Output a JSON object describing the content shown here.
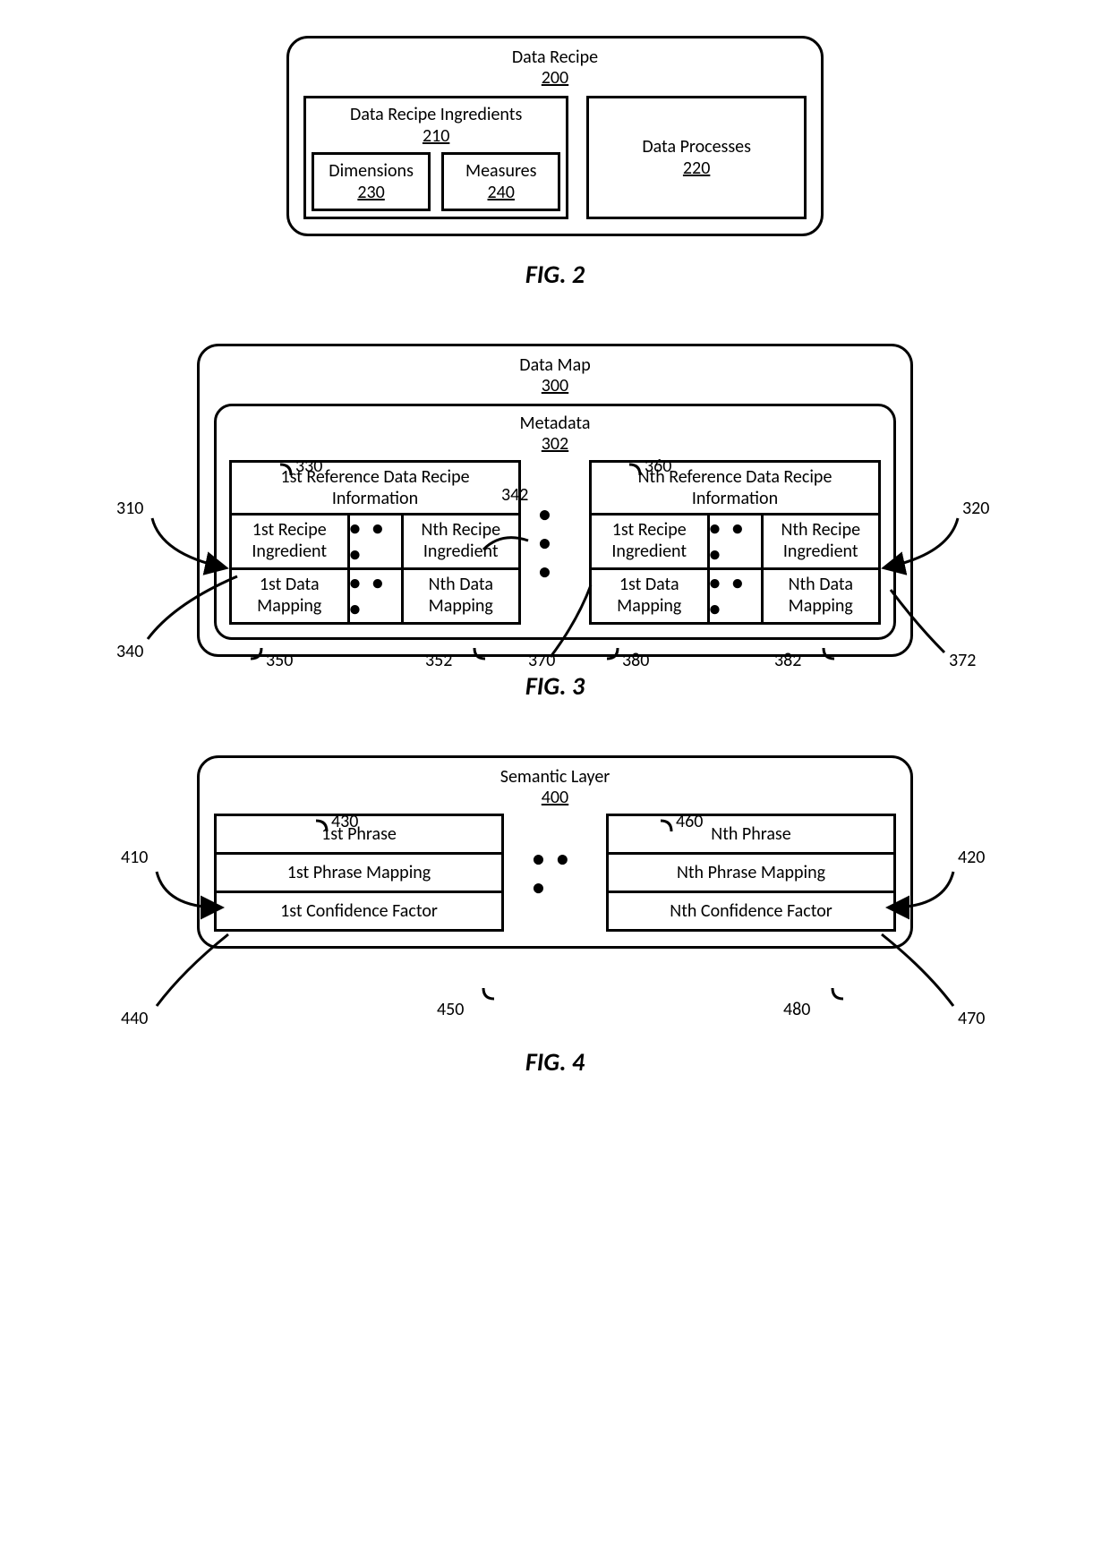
{
  "fig2": {
    "caption": "FIG. 2",
    "outer_title": "Data Recipe",
    "outer_num": "200",
    "ingredients_title": "Data Recipe Ingredients",
    "ingredients_num": "210",
    "dimensions_title": "Dimensions",
    "dimensions_num": "230",
    "measures_title": "Measures",
    "measures_num": "240",
    "processes_title": "Data Processes",
    "processes_num": "220"
  },
  "fig3": {
    "caption": "FIG. 3",
    "outer_title": "Data Map",
    "outer_num": "300",
    "meta_title": "Metadata",
    "meta_num": "302",
    "left_block_title": "1st Reference Data Recipe Information",
    "right_block_title": "Nth Reference Data Recipe Information",
    "left_r1_c1": "1st Recipe Ingredient",
    "left_r1_c3": "Nth Recipe Ingredient",
    "left_r2_c1": "1st Data Mapping",
    "left_r2_c3": "Nth Data Mapping",
    "right_r1_c1": "1st Recipe Ingredient",
    "right_r1_c3": "Nth Recipe Ingredient",
    "right_r2_c1": "1st Data Mapping",
    "right_r2_c3": "Nth Data Mapping",
    "lbl_310": "310",
    "lbl_320": "320",
    "lbl_330": "330",
    "lbl_340": "340",
    "lbl_342": "342",
    "lbl_350": "350",
    "lbl_352": "352",
    "lbl_360": "360",
    "lbl_370": "370",
    "lbl_372": "372",
    "lbl_380": "380",
    "lbl_382": "382",
    "dots": "• • •"
  },
  "fig4": {
    "caption": "FIG. 4",
    "outer_title": "Semantic Layer",
    "outer_num": "400",
    "left_c1": "1st Phrase",
    "left_c2": "1st Phrase Mapping",
    "left_c3": "1st Confidence Factor",
    "right_c1": "Nth Phrase",
    "right_c2": "Nth Phrase Mapping",
    "right_c3": "Nth Confidence Factor",
    "lbl_410": "410",
    "lbl_420": "420",
    "lbl_430": "430",
    "lbl_440": "440",
    "lbl_450": "450",
    "lbl_460": "460",
    "lbl_470": "470",
    "lbl_480": "480",
    "dots": "• • •"
  }
}
